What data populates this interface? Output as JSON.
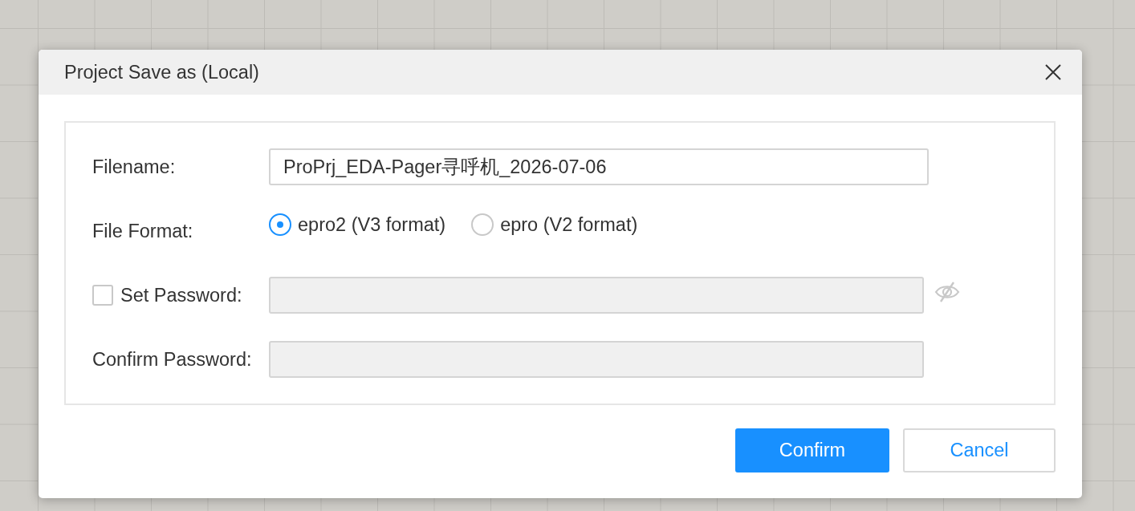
{
  "dialog": {
    "title": "Project Save as (Local)"
  },
  "fields": [
    {
      "kind": "text",
      "label": "Filename:",
      "value": "ProPrj_EDA-Pager寻呼机_2026-07-06"
    },
    {
      "kind": "radio",
      "label": "File Format:",
      "options": [
        {
          "label": "epro2 (V3 format)",
          "selected": true
        },
        {
          "label": "epro (V2 format)",
          "selected": false
        }
      ]
    },
    {
      "kind": "password",
      "label": "Set Password:",
      "checked": false,
      "disabled": true,
      "show_toggle": true
    },
    {
      "kind": "password",
      "label": "Confirm Password:",
      "disabled": true,
      "show_toggle": false
    }
  ],
  "buttons": [
    {
      "label": "Confirm",
      "kind": "primary"
    },
    {
      "label": "Cancel",
      "kind": "default"
    }
  ]
}
